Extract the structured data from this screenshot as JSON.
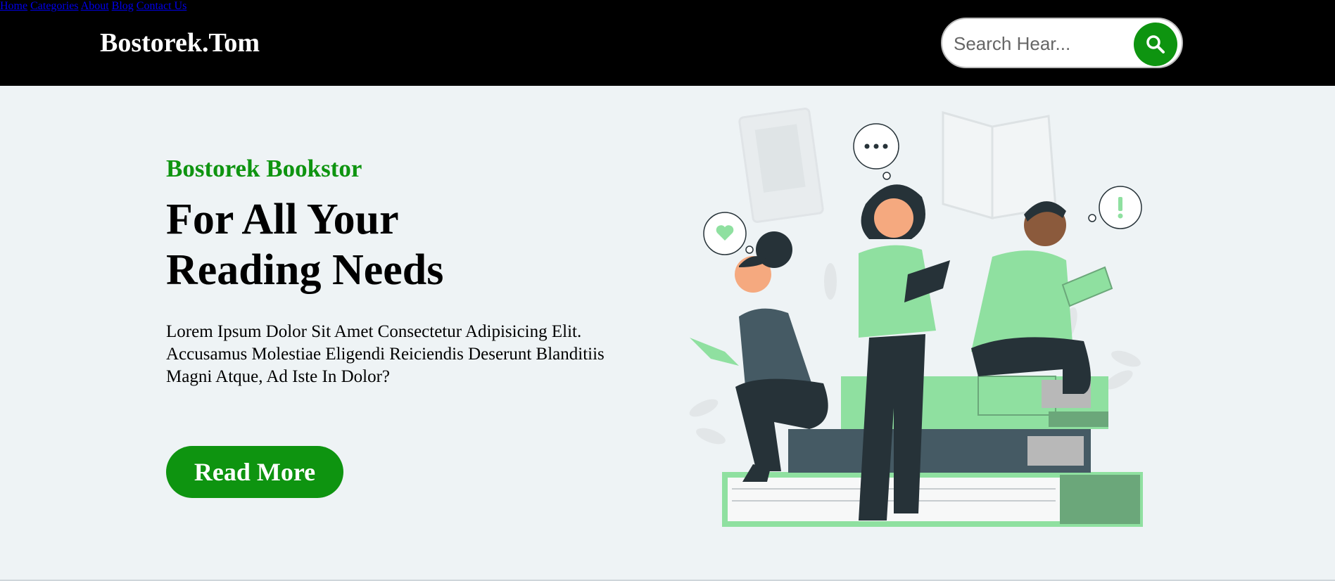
{
  "header": {
    "logo": "Bostorek.Tom",
    "nav": [
      "Home",
      "Categories",
      "About",
      "Blog",
      "Contact Us"
    ],
    "search_placeholder": "Search Hear...",
    "search_icon": "search-icon"
  },
  "hero": {
    "subtitle": "Bostorek Bookstor",
    "headline_line1": "For All Your",
    "headline_line2": "Reading Needs",
    "description": "Lorem Ipsum Dolor Sit Amet Consectetur Adipisicing Elit. Accusamus Molestiae Eligendi Reiciendis Deserunt Blanditiis Magni Atque, Ad Iste In Dolor?",
    "button_label": "Read More"
  },
  "colors": {
    "accent": "#0e9410",
    "header_bg": "#000000",
    "page_bg": "#eef3f5",
    "illustration_green": "#8fe0a0",
    "illustration_dark": "#263238"
  }
}
